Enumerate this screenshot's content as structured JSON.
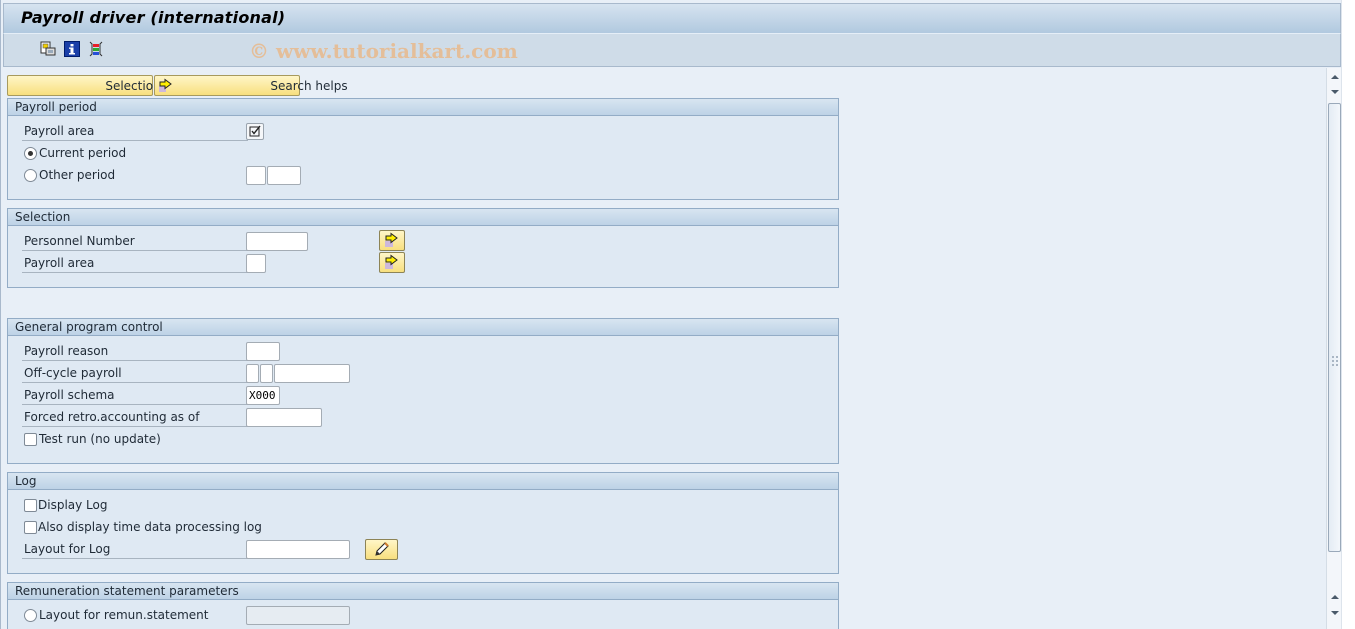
{
  "window": {
    "title": "Payroll driver (international)",
    "watermark": "© www.tutorialkart.com",
    "toolbar_icons": [
      "get-variant-icon",
      "program-info-icon",
      "dynamic-selection-icon"
    ]
  },
  "action_buttons": {
    "selections_from": "Selections from",
    "search_helps": "Search helps"
  },
  "groups": {
    "payroll_period": {
      "title": "Payroll period",
      "payroll_area_label": "Payroll area",
      "payroll_area_checked": true,
      "current_period_label": "Current period",
      "current_period_selected": true,
      "other_period_label": "Other period",
      "other_period_selected": false,
      "other_period_value_1": "",
      "other_period_value_2": ""
    },
    "selection": {
      "title": "Selection",
      "personnel_number_label": "Personnel Number",
      "personnel_number_value": "",
      "payroll_area_label": "Payroll area",
      "payroll_area_value": ""
    },
    "general": {
      "title": "General program control",
      "payroll_reason_label": "Payroll reason",
      "payroll_reason_value": "",
      "offcycle_label": "Off-cycle payroll",
      "offcycle_value_1": "",
      "offcycle_value_2": "",
      "offcycle_value_3": "",
      "schema_label": "Payroll schema",
      "schema_value": "X000",
      "forced_retro_label": "Forced retro.accounting as of",
      "forced_retro_value": "",
      "test_run_label": "Test run (no update)",
      "test_run_checked": false
    },
    "log": {
      "title": "Log",
      "display_log_label": "Display Log",
      "display_log_checked": false,
      "time_log_label": "Also display time data processing log",
      "time_log_checked": false,
      "layout_label": "Layout for Log",
      "layout_value": ""
    },
    "remuneration": {
      "title": "Remuneration statement parameters",
      "layout_label": "Layout for remun.statement",
      "layout_selected": false,
      "layout_value": ""
    }
  }
}
